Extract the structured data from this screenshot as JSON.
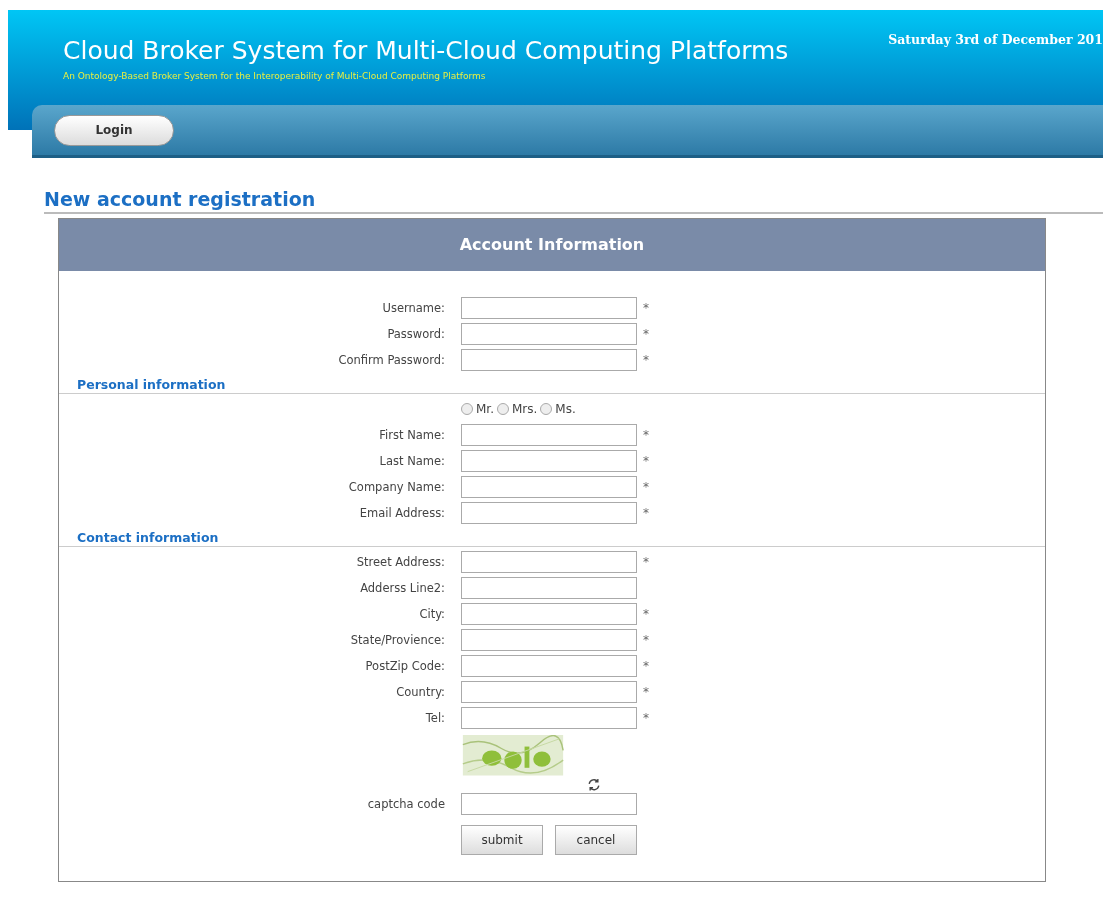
{
  "header": {
    "title": "Cloud Broker System for Multi-Cloud Computing Platforms",
    "subtitle": "An Ontology-Based Broker System for the Interoperability of Multi-Cloud Computing Platforms",
    "date": "Saturday 3rd of December 201"
  },
  "nav": {
    "buttons": [
      "Login"
    ]
  },
  "page_title": "New account registration",
  "form": {
    "title": "Account Information",
    "sections": [
      {
        "fields": [
          {
            "kind": "text",
            "label": "Username:",
            "required": true
          },
          {
            "kind": "text",
            "label": "Password:",
            "required": true
          },
          {
            "kind": "text",
            "label": "Confirm Password:",
            "required": true
          }
        ]
      },
      {
        "heading": "Personal information",
        "fields": [
          {
            "kind": "radio",
            "options": [
              {
                "label": "Mr.",
                "selected": false
              },
              {
                "label": "Mrs.",
                "selected": false
              },
              {
                "label": "Ms.",
                "selected": false
              }
            ]
          },
          {
            "kind": "text",
            "label": "First Name:",
            "required": true
          },
          {
            "kind": "text",
            "label": "Last Name:",
            "required": true
          },
          {
            "kind": "text",
            "label": "Company Name:",
            "required": true
          },
          {
            "kind": "text",
            "label": "Email Address:",
            "required": true
          }
        ]
      },
      {
        "heading": "Contact information",
        "fields": [
          {
            "kind": "text",
            "label": "Street Address:",
            "required": true
          },
          {
            "kind": "text",
            "label": "Adderss Line2:",
            "required": false
          },
          {
            "kind": "text",
            "label": "City:",
            "required": true
          },
          {
            "kind": "text",
            "label": "State/Provience:",
            "required": true
          },
          {
            "kind": "text",
            "label": "PostZip Code:",
            "required": true
          },
          {
            "kind": "text",
            "label": "Country:",
            "required": true
          },
          {
            "kind": "text",
            "label": "Tel:",
            "required": true
          },
          {
            "kind": "captcha"
          },
          {
            "kind": "text",
            "label": "captcha code",
            "required": false
          }
        ]
      }
    ],
    "buttons": [
      "submit",
      "cancel"
    ]
  },
  "required_mark": "*"
}
